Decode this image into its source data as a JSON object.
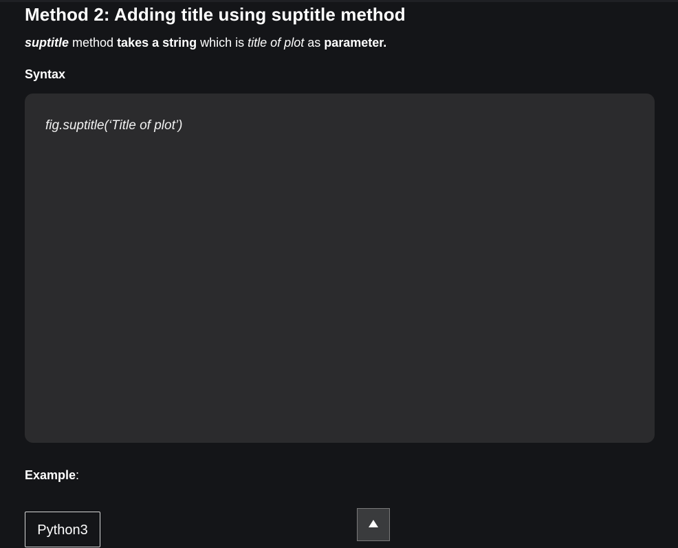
{
  "article": {
    "title": "Method 2: Adding title using suptitle method",
    "intro": {
      "method_name": "suptitle",
      "text1": " method ",
      "bold1": "takes a string",
      "text2": " which is ",
      "italic1": "title of plot",
      "text3": " as ",
      "bold2": "parameter."
    },
    "syntax_label": "Syntax",
    "syntax_code": "fig.suptitle(‘Title of plot’)",
    "example_label": "Example",
    "example_colon": ":",
    "code_tab_label": "Python3"
  },
  "scroll_top_button": {
    "icon": "arrow-up-icon"
  },
  "colors": {
    "page_background": "#141518",
    "code_background": "#2b2b2d",
    "text": "#ffffff"
  }
}
